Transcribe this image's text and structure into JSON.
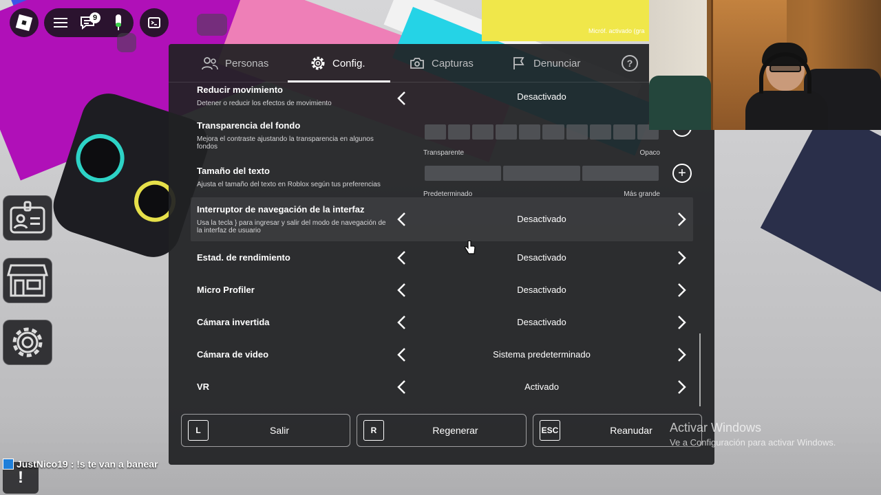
{
  "mic_status": "Micróf. activado (gra",
  "toolbar": {
    "roblox_icon": "roblox-logo-icon",
    "menu_icon": "hamburger-icon",
    "chat_icon": "chat-icon",
    "chat_badge": "9",
    "mic_icon": "microphone-icon",
    "console_icon": "console-icon"
  },
  "tabs": [
    {
      "label": "Personas",
      "icon": "people-icon"
    },
    {
      "label": "Config.",
      "icon": "gear-icon",
      "active": true
    },
    {
      "label": "Capturas",
      "icon": "camera-icon"
    },
    {
      "label": "Denunciar",
      "icon": "flag-icon"
    }
  ],
  "help_label": "?",
  "settings": {
    "reduce_motion": {
      "label": "Reducir movimiento",
      "desc": "Detener o reducir los efectos de movimiento",
      "value": "Desactivado"
    },
    "bg_transparency": {
      "label": "Transparencia del fondo",
      "desc": "Mejora el contraste ajustando la transparencia en algunos fondos",
      "min_label": "Transparente",
      "max_label": "Opaco",
      "level": 1.0
    },
    "text_size": {
      "label": "Tamaño del texto",
      "desc": "Ajusta el tamaño del texto en Roblox según tus preferencias",
      "min_label": "Predeterminado",
      "max_label": "Más grande",
      "level": 0.0
    },
    "ui_nav_toggle": {
      "label": "Interruptor de navegación de la interfaz",
      "desc": "Usa la tecla } para ingresar y salir del modo de navegación de la interfaz de usuario",
      "value": "Desactivado"
    },
    "perf_stats": {
      "label": "Estad. de rendimiento",
      "value": "Desactivado"
    },
    "micro_profiler": {
      "label": "Micro Profiler",
      "value": "Desactivado"
    },
    "inverted_camera": {
      "label": "Cámara invertida",
      "value": "Desactivado"
    },
    "video_camera": {
      "label": "Cámara de video",
      "value": "Sistema predeterminado"
    },
    "vr": {
      "label": "VR",
      "value": "Activado"
    }
  },
  "bottom_buttons": {
    "leave": {
      "key": "L",
      "label": "Salir"
    },
    "reset": {
      "key": "R",
      "label": "Regenerar"
    },
    "resume": {
      "key": "ESC",
      "label": "Reanudar"
    }
  },
  "chat": {
    "user": "JustNico19",
    "message": ": !s te van a banear"
  },
  "alert_glyph": "!",
  "watermark": {
    "title": "Activar Windows",
    "subtitle": "Ve a Configuración para activar Windows."
  }
}
